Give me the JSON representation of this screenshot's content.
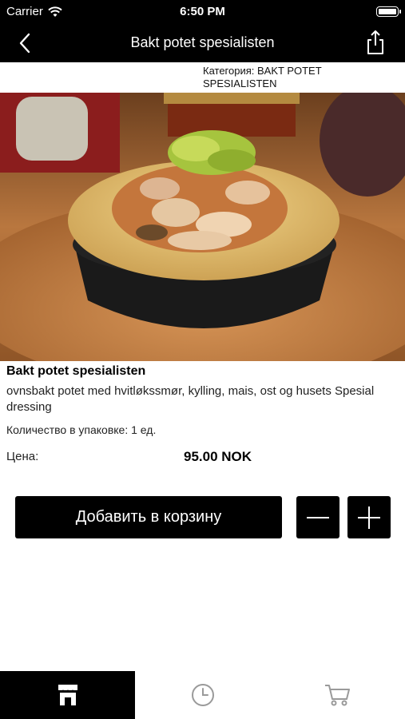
{
  "status_bar": {
    "carrier": "Carrier",
    "time": "6:50 PM"
  },
  "nav": {
    "title": "Bakt potet spesialisten",
    "back_icon": "chevron-left-icon",
    "share_icon": "share-icon"
  },
  "category": "Категория: BAKT POTET SPESIALISTEN",
  "product": {
    "title": "Bakt potet spesialisten",
    "description": "ovnsbakt potet med hvitløkssmør, kylling, mais, ost og husets Spesial dressing",
    "package_info": "Количество в упаковке: 1 ед.",
    "price_label": "Цена:",
    "price_value": "95.00 NOK"
  },
  "actions": {
    "add_to_cart": "Добавить в корзину",
    "minus_icon": "minus-icon",
    "plus_icon": "plus-icon"
  },
  "tab_bar": {
    "tabs": [
      {
        "icon": "shop-icon",
        "active": true
      },
      {
        "icon": "clock-icon",
        "active": false
      },
      {
        "icon": "cart-icon",
        "active": false
      }
    ]
  },
  "colors": {
    "bar_bg": "#000000",
    "page_bg": "#ffffff",
    "inactive_icon": "#9a9a9a"
  }
}
